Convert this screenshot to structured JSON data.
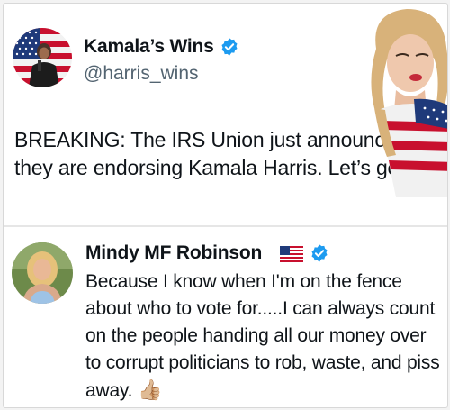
{
  "tweets": [
    {
      "display_name": "Kamala’s Wins",
      "handle": "@harris_wins",
      "verified": true,
      "avatar_icon": "flag-avatar-photo",
      "text": "BREAKING: The IRS Union just announced they are endorsing Kamala Harris. Let’s go!"
    },
    {
      "display_name": "Mindy MF Robinson",
      "verified": true,
      "name_emoji": "us-flag-icon",
      "avatar_icon": "person-avatar-photo",
      "text": "Because I know when I'm on the fence about who to vote for.....I can always count on the people handing all our money over to corrupt politicians to rob, waste, and piss away.",
      "trailing_emoji": "👍🏼"
    }
  ],
  "colors": {
    "verified_blue": "#1d9bf0",
    "handle_gray": "#536471",
    "text": "#0f1419"
  }
}
